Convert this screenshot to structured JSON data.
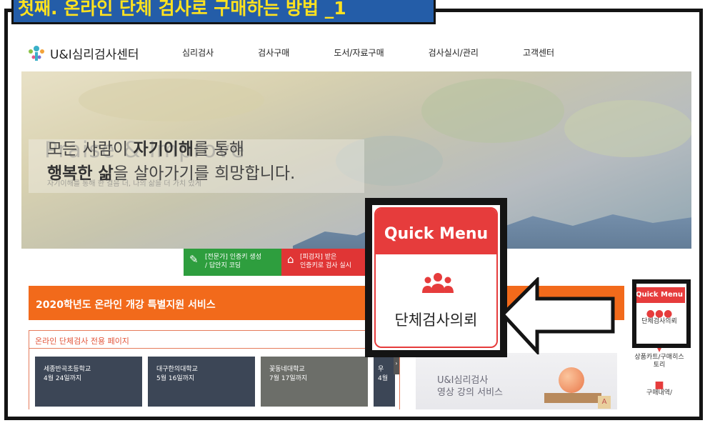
{
  "slide_title": "첫째. 온라인 단체 검사로 구매하는 방법 _1",
  "site": {
    "logo_text": "U&I심리검사센터",
    "nav": [
      "심리검사",
      "검사구매",
      "도서/자료구매",
      "검사실시/관리",
      "고객센터"
    ]
  },
  "hero": {
    "headline_line1_pre": "모든 사람이 ",
    "headline_line1_bold": "자기이해",
    "headline_line1_post": "를 통해",
    "headline_line2_bold": "행복한 삶",
    "headline_line2_post": "을 살아가기를 희망합니다.",
    "ghost_text": "Praise & Improve",
    "sub_text": "자기이해를 통해 한 걸음 더, 나의 삶을 더 가치 있게",
    "slides": 5,
    "active_slide": 1
  },
  "actions": {
    "expert_line1": "[전문가] 인증키 생성",
    "expert_line2": "/ 답안지 코딩",
    "tester_line1": "[피검자] 받은",
    "tester_line2": "인증키로 검사 실시"
  },
  "service_bar": "2020학년도 온라인 개강 특별지원 서비스",
  "group_page": {
    "title": "온라인 단체검사 전용 페이지",
    "cards": [
      {
        "name": "세종반곡초등학교",
        "date": "4월 24일까지"
      },
      {
        "name": "대구한의대학교",
        "date": "5월 16일까지"
      },
      {
        "name": "꽃동네대학교",
        "date": "7월 17일까지"
      },
      {
        "name": "우",
        "date": "4월"
      }
    ]
  },
  "video_box": {
    "line1": "U&I심리검사",
    "line2": "영상 강의 서비스"
  },
  "quick_menu": {
    "header": "Quick Menu",
    "items": [
      "단체검사의뢰",
      "상품카트/구매히스토리",
      "구매내역/"
    ]
  },
  "zoom": {
    "header": "Quick Menu",
    "label": "단체검사의뢰"
  },
  "colors": {
    "title_bg": "#245da8",
    "title_text": "#ffe21f",
    "accent_red": "#e63c3c",
    "orange": "#f26a1b",
    "green": "#2e9e3e"
  }
}
